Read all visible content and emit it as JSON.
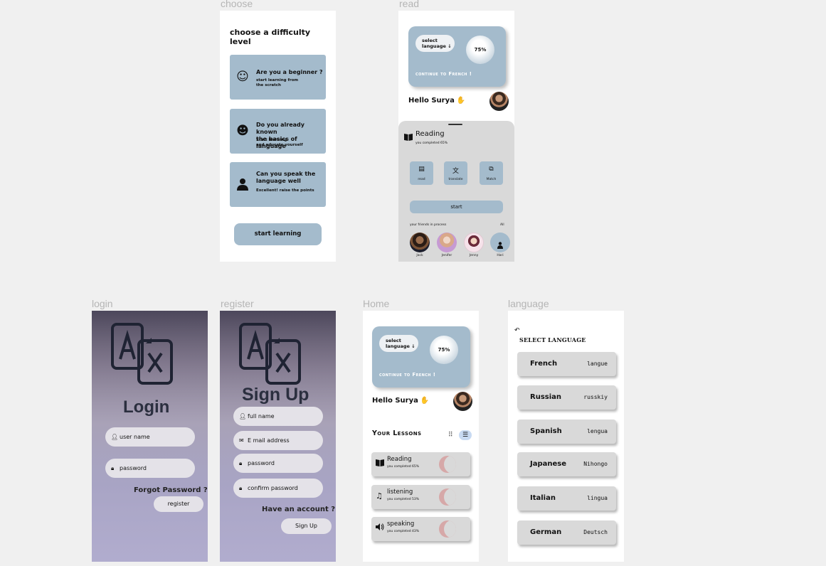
{
  "frame_titles": {
    "choose": "choose",
    "read": "read",
    "login": "login",
    "register": "register",
    "home": "Home",
    "language": "language"
  },
  "choose": {
    "heading": "choose a difficulty level",
    "options": [
      {
        "title": "Are you a beginner ?",
        "subtitle": "start learning from\n the scratch",
        "icon": "baby-face-icon"
      },
      {
        "title": "Do you already known\nthe basics of language",
        "subtitle": "Start learning\nand educate yourself",
        "icon": "child-face-icon"
      },
      {
        "title": "Can you speak the\n language well",
        "subtitle": "Excellent! raise the points",
        "icon": "person-icon"
      }
    ],
    "button": "start learning"
  },
  "hero": {
    "select_language": "select\nlanguage ↓",
    "progress": "75%",
    "progress_value": 75,
    "continue": "continue to French !"
  },
  "greeting": "Hello Surya",
  "read": {
    "title": "Reading",
    "subtitle": "you completed 65%",
    "tools": [
      "read",
      "translate",
      "Match"
    ],
    "start": "start",
    "friends_label": "your friends in process",
    "all_label": "All",
    "friends": [
      "Jack",
      "Jenifer",
      "Jenny",
      "Hari"
    ]
  },
  "login": {
    "title": "Login",
    "fields": [
      "user name",
      "password"
    ],
    "forgot": "Forgot Password ?",
    "button": "register"
  },
  "register": {
    "title": "Sign Up",
    "fields": [
      "full name",
      "E mail address",
      "password",
      "confirm password"
    ],
    "have_account": "Have an account ?",
    "button": "Sign Up"
  },
  "home": {
    "lessons_heading": "Your Lessons",
    "lessons": [
      {
        "name": "Reading",
        "progress": "you completed 65%",
        "icon": "book-icon"
      },
      {
        "name": "listening",
        "progress": "you completed 53%",
        "icon": "music-note-icon"
      },
      {
        "name": "speaking",
        "progress": "you completed 43%",
        "icon": "speaker-icon"
      }
    ]
  },
  "language": {
    "heading": "SELECT LANGUAGE",
    "items": [
      {
        "name": "French",
        "native": "langue"
      },
      {
        "name": "Russian",
        "native": "russkiy"
      },
      {
        "name": "Spanish",
        "native": "lengua"
      },
      {
        "name": "Japanese",
        "native": "Nihongo"
      },
      {
        "name": "Italian",
        "native": "lingua"
      },
      {
        "name": "German",
        "native": "Deutsch"
      }
    ]
  },
  "colors": {
    "card_blue": "#a4bbcc",
    "card_grey": "#d9d9d9",
    "canvas": "#f0f0f0",
    "moon_pink": "#d6a8a8",
    "frame_title": "#b5b5b5"
  }
}
